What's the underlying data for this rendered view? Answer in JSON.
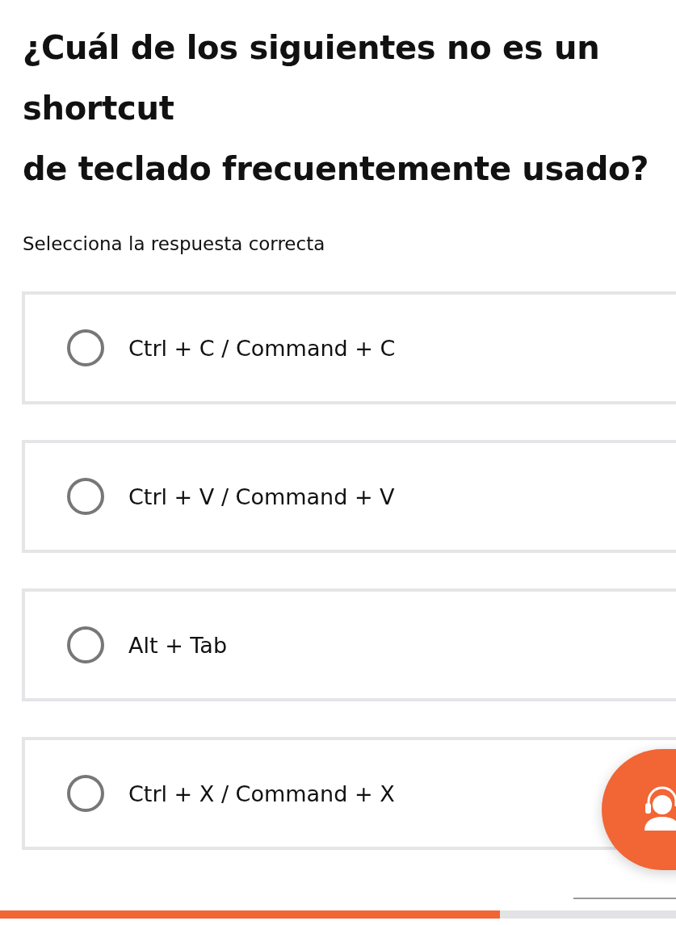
{
  "question": "¿Cuál de los siguientes no es un shortcut\nde teclado frecuentemente usado?",
  "instruction": "Selecciona la respuesta correcta",
  "options": [
    {
      "label": "Ctrl + C / Command + C",
      "selected": false
    },
    {
      "label": "Ctrl + V / Command + V",
      "selected": false
    },
    {
      "label": "Alt + Tab",
      "selected": false
    },
    {
      "label": "Ctrl + X / Command + X",
      "selected": false
    }
  ],
  "progress": {
    "level": 0.74
  }
}
